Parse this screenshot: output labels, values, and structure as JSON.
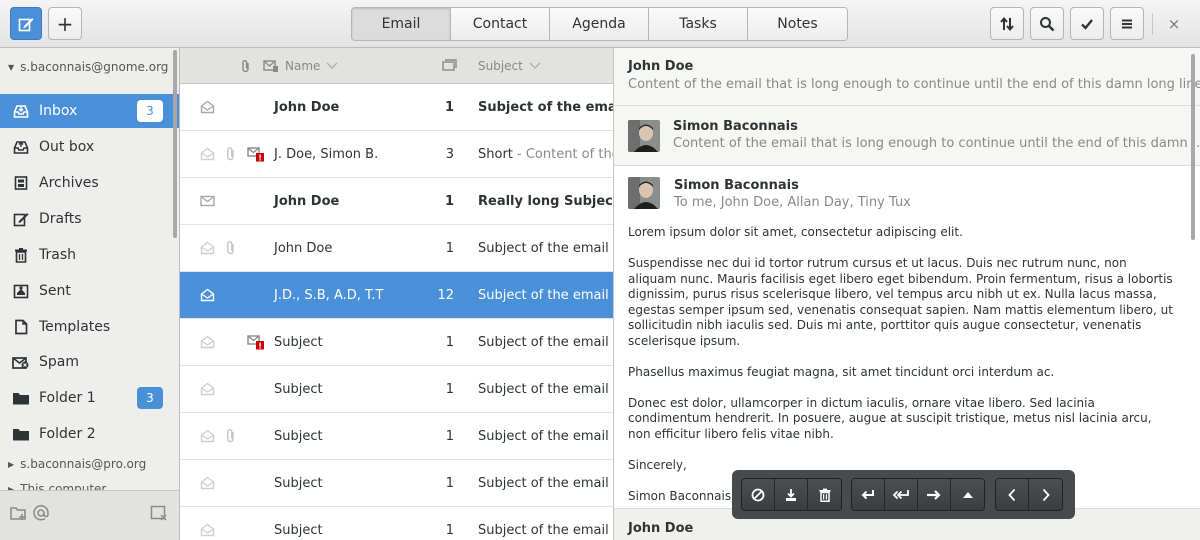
{
  "header": {
    "compose_icon": "compose-icon",
    "add_label": "+",
    "tabs": [
      "Email",
      "Contact",
      "Agenda",
      "Tasks",
      "Notes"
    ],
    "active_tab": "Email",
    "close_label": "×"
  },
  "sidebar": {
    "account1": "s.baconnais@gnome.org",
    "items": [
      {
        "label": "Inbox",
        "icon": "inbox-icon",
        "badge": "3"
      },
      {
        "label": "Out box",
        "icon": "outbox-icon"
      },
      {
        "label": "Archives",
        "icon": "archive-icon"
      },
      {
        "label": "Drafts",
        "icon": "drafts-icon"
      },
      {
        "label": "Trash",
        "icon": "trash-icon"
      },
      {
        "label": "Sent",
        "icon": "sent-icon"
      },
      {
        "label": "Templates",
        "icon": "templates-icon"
      },
      {
        "label": "Spam",
        "icon": "spam-icon"
      },
      {
        "label": "Folder 1",
        "icon": "folder-icon",
        "badge": "3"
      },
      {
        "label": "Folder 2",
        "icon": "folder-icon"
      }
    ],
    "account2": "s.baconnais@pro.org",
    "account3": "This computer"
  },
  "list": {
    "headers": {
      "name": "Name",
      "subject": "Subject"
    },
    "rows": [
      {
        "name": "John Doe",
        "count": "1",
        "subject": "Subject of the email",
        "preview": " - ",
        "attach": false,
        "flag": false,
        "bold": true
      },
      {
        "name": "J. Doe, Simon B.",
        "count": "3",
        "subject": "Short",
        "preview": " - Content of the",
        "attach": true,
        "flag": true,
        "bold": false
      },
      {
        "name": "John Doe",
        "count": "1",
        "subject": "Really long Subject of",
        "preview": "",
        "attach": false,
        "flag": false,
        "bold": true
      },
      {
        "name": "John Doe",
        "count": "1",
        "subject": "Subject of the email",
        "preview": " - ",
        "attach": true,
        "flag": false,
        "bold": false
      },
      {
        "name": "J.D., S.B, A.D, T.T",
        "count": "12",
        "subject": "Subject of the email",
        "preview": " ",
        "attach": false,
        "flag": false,
        "bold": false
      },
      {
        "name": "Subject",
        "count": "1",
        "subject": "Subject of the email",
        "preview": " - ",
        "attach": false,
        "flag": true,
        "bold": false
      },
      {
        "name": "Subject",
        "count": "1",
        "subject": "Subject of the email",
        "preview": " - ",
        "attach": false,
        "flag": false,
        "bold": false
      },
      {
        "name": "Subject",
        "count": "1",
        "subject": "Subject of the email",
        "preview": " - ",
        "attach": true,
        "flag": false,
        "bold": false
      },
      {
        "name": "Subject",
        "count": "1",
        "subject": "Subject of the email",
        "preview": " - ",
        "attach": false,
        "flag": false,
        "bold": false
      },
      {
        "name": "Subject",
        "count": "1",
        "subject": "Subject of the email",
        "preview": "",
        "attach": false,
        "flag": false,
        "bold": false
      }
    ]
  },
  "reader": {
    "msg1": {
      "from": "John Doe",
      "snippet": "Content of the email that is long enough to continue until the end of this damn long line a ..."
    },
    "msg2": {
      "from": "Simon Baconnais",
      "snippet": "Content of the email that is long enough to continue until the end of this damn ..."
    },
    "msg3": {
      "from": "Simon Baconnais",
      "to": "To me, John Doe,  Allan Day, Tiny Tux",
      "paragraphs": [
        "Lorem ipsum dolor sit amet, consectetur adipiscing elit.",
        "Suspendisse nec dui id tortor rutrum cursus et ut lacus. Duis nec rutrum nunc, non aliquam nunc. Mauris facilisis eget libero eget bibendum. Proin fermentum, risus a lobortis dignissim, purus risus scelerisque libero, vel tempus arcu nibh ut ex. Nulla lacus massa, egestas semper ipsum sed, venenatis consequat sapien. Nam mattis elementum libero, ut sollicitudin nibh iaculis sed. Duis mi ante, porttitor quis augue consectetur, venenatis scelerisque ipsum.",
        "Phasellus maximus feugiat magna, sit amet tincidunt orci interdum ac.",
        "Donec est dolor, ullamcorper in dictum iaculis, ornare vitae libero. Sed lacinia condimentum hendrerit. In posuere, augue at suscipit tristique, metus nisl lacinia arcu, non efficitur libero felis vitae nibh.",
        "Sincerely,",
        "Simon Baconnais."
      ]
    },
    "msg4": {
      "from": "John Doe"
    }
  },
  "colors": {
    "accent": "#4a90d9",
    "flag": "#cc0000"
  }
}
